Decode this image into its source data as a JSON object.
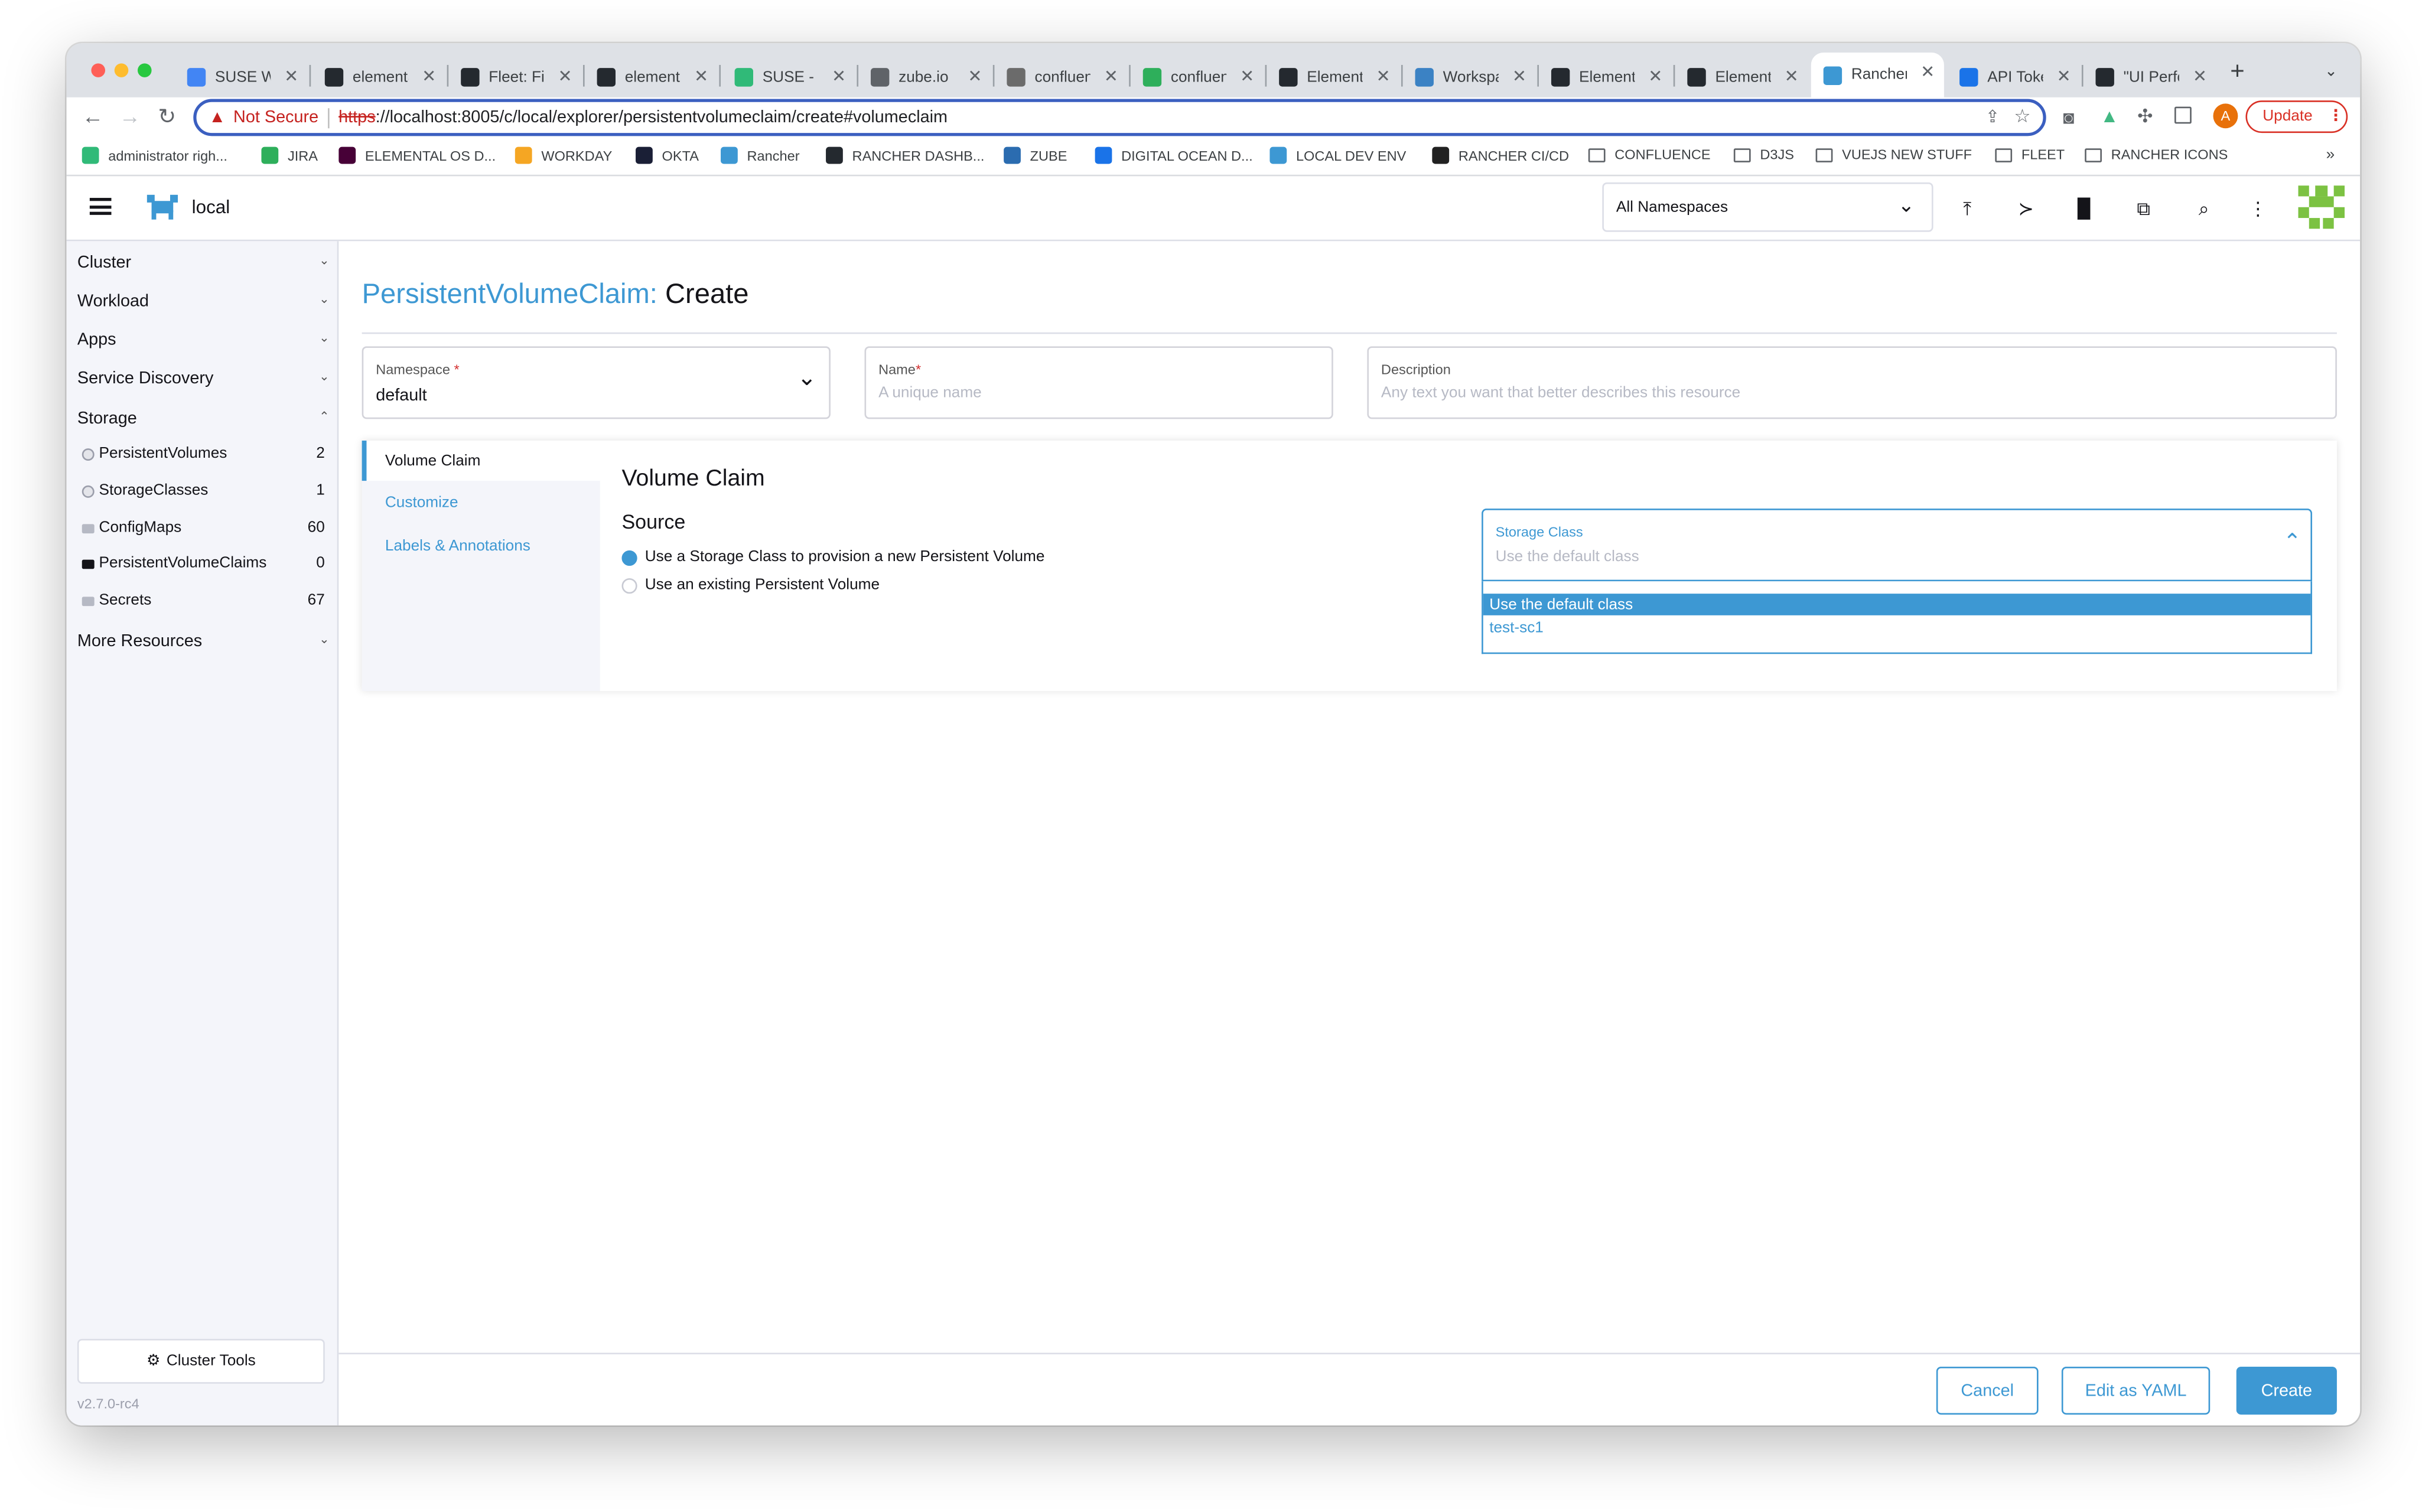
{
  "browser": {
    "tabs": [
      {
        "title": "SUSE W",
        "icon": "docs-icon",
        "color": "#4285f4"
      },
      {
        "title": "elementa",
        "icon": "github-icon",
        "color": "#24292f"
      },
      {
        "title": "Fleet: Fix",
        "icon": "github-icon",
        "color": "#24292f"
      },
      {
        "title": "elementa",
        "icon": "github-icon",
        "color": "#24292f"
      },
      {
        "title": "SUSE - S",
        "icon": "suse-icon",
        "color": "#30ba78"
      },
      {
        "title": "zube.io",
        "icon": "globe-icon",
        "color": "#5f6368"
      },
      {
        "title": "confluen",
        "icon": "confluence-icon",
        "color": "#6b6b6b"
      },
      {
        "title": "confluen",
        "icon": "confluence-icon",
        "color": "#2eaf5b"
      },
      {
        "title": "Elementa",
        "icon": "github-icon",
        "color": "#24292f"
      },
      {
        "title": "Workspa",
        "icon": "workspace-icon",
        "color": "#3b82c4"
      },
      {
        "title": "Elementa",
        "icon": "github-icon",
        "color": "#24292f"
      },
      {
        "title": "Elementa",
        "icon": "github-icon",
        "color": "#24292f"
      },
      {
        "title": "Rancher",
        "icon": "rancher-icon",
        "color": "#3d98d3"
      },
      {
        "title": "API Toke",
        "icon": "digitalocean-icon",
        "color": "#1a73e8"
      },
      {
        "title": "\"UI Perfo",
        "icon": "github-icon",
        "color": "#24292f"
      }
    ],
    "not_secure": "Not Secure",
    "url_scheme": "https",
    "url_rest": "://localhost:8005/c/local/explorer/persistentvolumeclaim/create#volumeclaim",
    "update_label": "Update",
    "profile_initial": "A",
    "bookmarks": [
      {
        "label": "administrator righ...",
        "icon": "rancher-icon",
        "color": "#30ba78"
      },
      {
        "label": "JIRA",
        "icon": "jira-icon",
        "color": "#2eaf5b"
      },
      {
        "label": "ELEMENTAL OS D...",
        "icon": "xd-icon",
        "color": "#470137"
      },
      {
        "label": "WORKDAY",
        "icon": "workday-icon",
        "color": "#f5a623"
      },
      {
        "label": "OKTA",
        "icon": "okta-icon",
        "color": "#1a1f36"
      },
      {
        "label": "Rancher",
        "icon": "rancher-icon",
        "color": "#3d98d3"
      },
      {
        "label": "RANCHER DASHB...",
        "icon": "github-icon",
        "color": "#24292f"
      },
      {
        "label": "ZUBE",
        "icon": "zube-icon",
        "color": "#2b6cb0"
      },
      {
        "label": "DIGITAL OCEAN D...",
        "icon": "digitalocean-icon",
        "color": "#1a73e8"
      },
      {
        "label": "LOCAL DEV ENV",
        "icon": "rancher-icon",
        "color": "#3d98d3"
      },
      {
        "label": "RANCHER CI/CD",
        "icon": "drone-icon",
        "color": "#212121"
      },
      {
        "label": "CONFLUENCE",
        "icon": "folder-icon",
        "color": "#5f6368"
      },
      {
        "label": "D3JS",
        "icon": "folder-icon",
        "color": "#5f6368"
      },
      {
        "label": "VUEJS NEW STUFF",
        "icon": "folder-icon",
        "color": "#5f6368"
      },
      {
        "label": "FLEET",
        "icon": "folder-icon",
        "color": "#5f6368"
      },
      {
        "label": "RANCHER ICONS",
        "icon": "folder-icon",
        "color": "#5f6368"
      }
    ],
    "more_bookmarks": "»"
  },
  "header": {
    "cluster_name": "local",
    "namespace_filter": "All Namespaces"
  },
  "sidebar": {
    "groups": {
      "cluster": "Cluster",
      "workload": "Workload",
      "apps": "Apps",
      "service_discovery": "Service Discovery",
      "storage": "Storage",
      "more_resources": "More Resources"
    },
    "storage_items": [
      {
        "label": "PersistentVolumes",
        "count": "2",
        "icon": "circle-icon"
      },
      {
        "label": "StorageClasses",
        "count": "1",
        "icon": "circle-icon"
      },
      {
        "label": "ConfigMaps",
        "count": "60",
        "icon": "folder-icon"
      },
      {
        "label": "PersistentVolumeClaims",
        "count": "0",
        "icon": "folder-icon",
        "active": true
      },
      {
        "label": "Secrets",
        "count": "67",
        "icon": "folder-icon"
      }
    ],
    "cluster_tools": "Cluster Tools",
    "version": "v2.7.0-rc4"
  },
  "page": {
    "title_resource": "PersistentVolumeClaim:",
    "title_action": "Create"
  },
  "form": {
    "namespace": {
      "label": "Namespace",
      "value": "default"
    },
    "name": {
      "label": "Name",
      "placeholder": "A unique name"
    },
    "description": {
      "label": "Description",
      "placeholder": "Any text you want that better describes this resource"
    }
  },
  "sections": {
    "tabs": [
      "Volume Claim",
      "Customize",
      "Labels & Annotations"
    ],
    "heading": "Volume Claim",
    "source_heading": "Source",
    "radio_options": [
      {
        "label": "Use a Storage Class to provision a new Persistent Volume",
        "selected": true
      },
      {
        "label": "Use an existing Persistent Volume",
        "selected": false
      }
    ],
    "storage_class": {
      "label": "Storage Class",
      "value": "Use the default class",
      "options": [
        "Use the default class",
        "test-sc1"
      ]
    }
  },
  "footer": {
    "cancel": "Cancel",
    "edit_yaml": "Edit as YAML",
    "create": "Create"
  },
  "colors": {
    "accent": "#3d98d3",
    "sidebar_bg": "#f4f5fa",
    "selected_option_bg": "#3d98d3",
    "not_secure": "#c5221f"
  }
}
